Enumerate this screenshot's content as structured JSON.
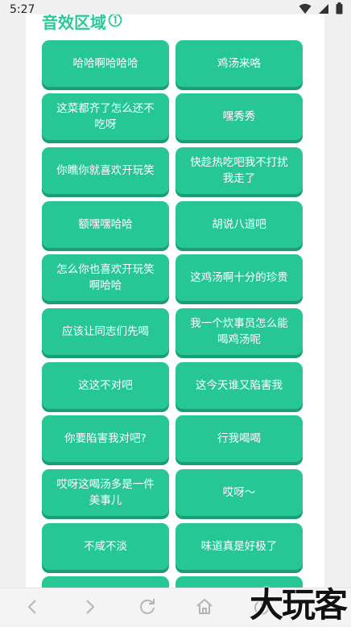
{
  "status_bar": {
    "time": "5:27",
    "icons": [
      "wifi-icon",
      "signal-icon",
      "battery-icon"
    ]
  },
  "section": {
    "title": "音效区域",
    "info_icon": "circled-one-icon"
  },
  "buttons": [
    "哈哈啊哈哈哈",
    "鸡汤来咯",
    "这菜都齐了怎么还不吃呀",
    "嘿秀秀",
    "你瞧你就喜欢开玩笑",
    "快趁热吃吧我不打扰我走了",
    "额嘿嘿哈哈",
    "胡说八道吧",
    "怎么你也喜欢开玩笑啊哈哈",
    "这鸡汤啊十分的珍贵",
    "应该让同志们先喝",
    "我一个炊事员怎么能喝鸡汤呢",
    "这这不对吧",
    "这今天谁又陷害我",
    "你要陷害我对吧?",
    "行我喝喝",
    "哎呀这喝汤多是一件美事儿",
    "哎呀～",
    "不咸不淡",
    "味道真是好极了",
    "",
    ""
  ],
  "nav_bar": {
    "icons": [
      "back-arrow-icon",
      "forward-arrow-icon",
      "refresh-icon",
      "home-icon",
      "power-icon"
    ]
  },
  "watermark": "大玩客",
  "colors": {
    "accent": "#26c794",
    "accent_shadow": "#1c9d74",
    "title": "#2bc797"
  }
}
